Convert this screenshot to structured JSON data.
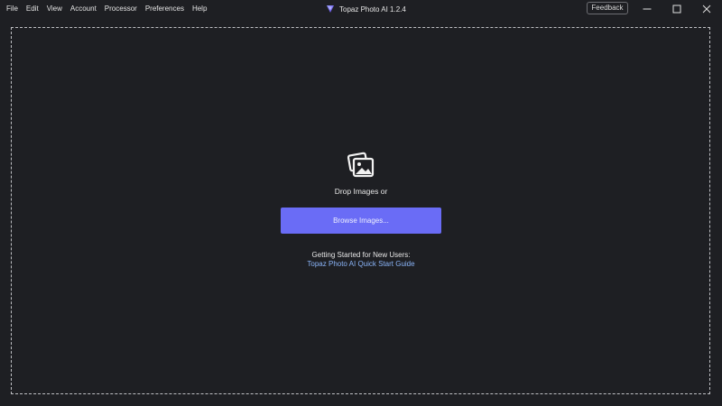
{
  "menu": {
    "items": [
      {
        "label": "File"
      },
      {
        "label": "Edit"
      },
      {
        "label": "View"
      },
      {
        "label": "Account"
      },
      {
        "label": "Processor"
      },
      {
        "label": "Preferences"
      },
      {
        "label": "Help"
      }
    ]
  },
  "window": {
    "title": "Topaz Photo AI 1.2.4",
    "feedback_label": "Feedback",
    "logo_icon": "topaz-logo-icon",
    "controls": [
      "minimize-icon",
      "maximize-icon",
      "close-icon"
    ]
  },
  "dropzone": {
    "icon": "images-icon",
    "drop_text": "Drop Images or",
    "browse_label": "Browse Images...",
    "getting_started": "Getting Started for New Users:",
    "guide_link": "Topaz Photo AI Quick Start Guide"
  },
  "colors": {
    "background": "#1e1f23",
    "accent": "#6a6cf6",
    "link": "#8ab4f8"
  }
}
